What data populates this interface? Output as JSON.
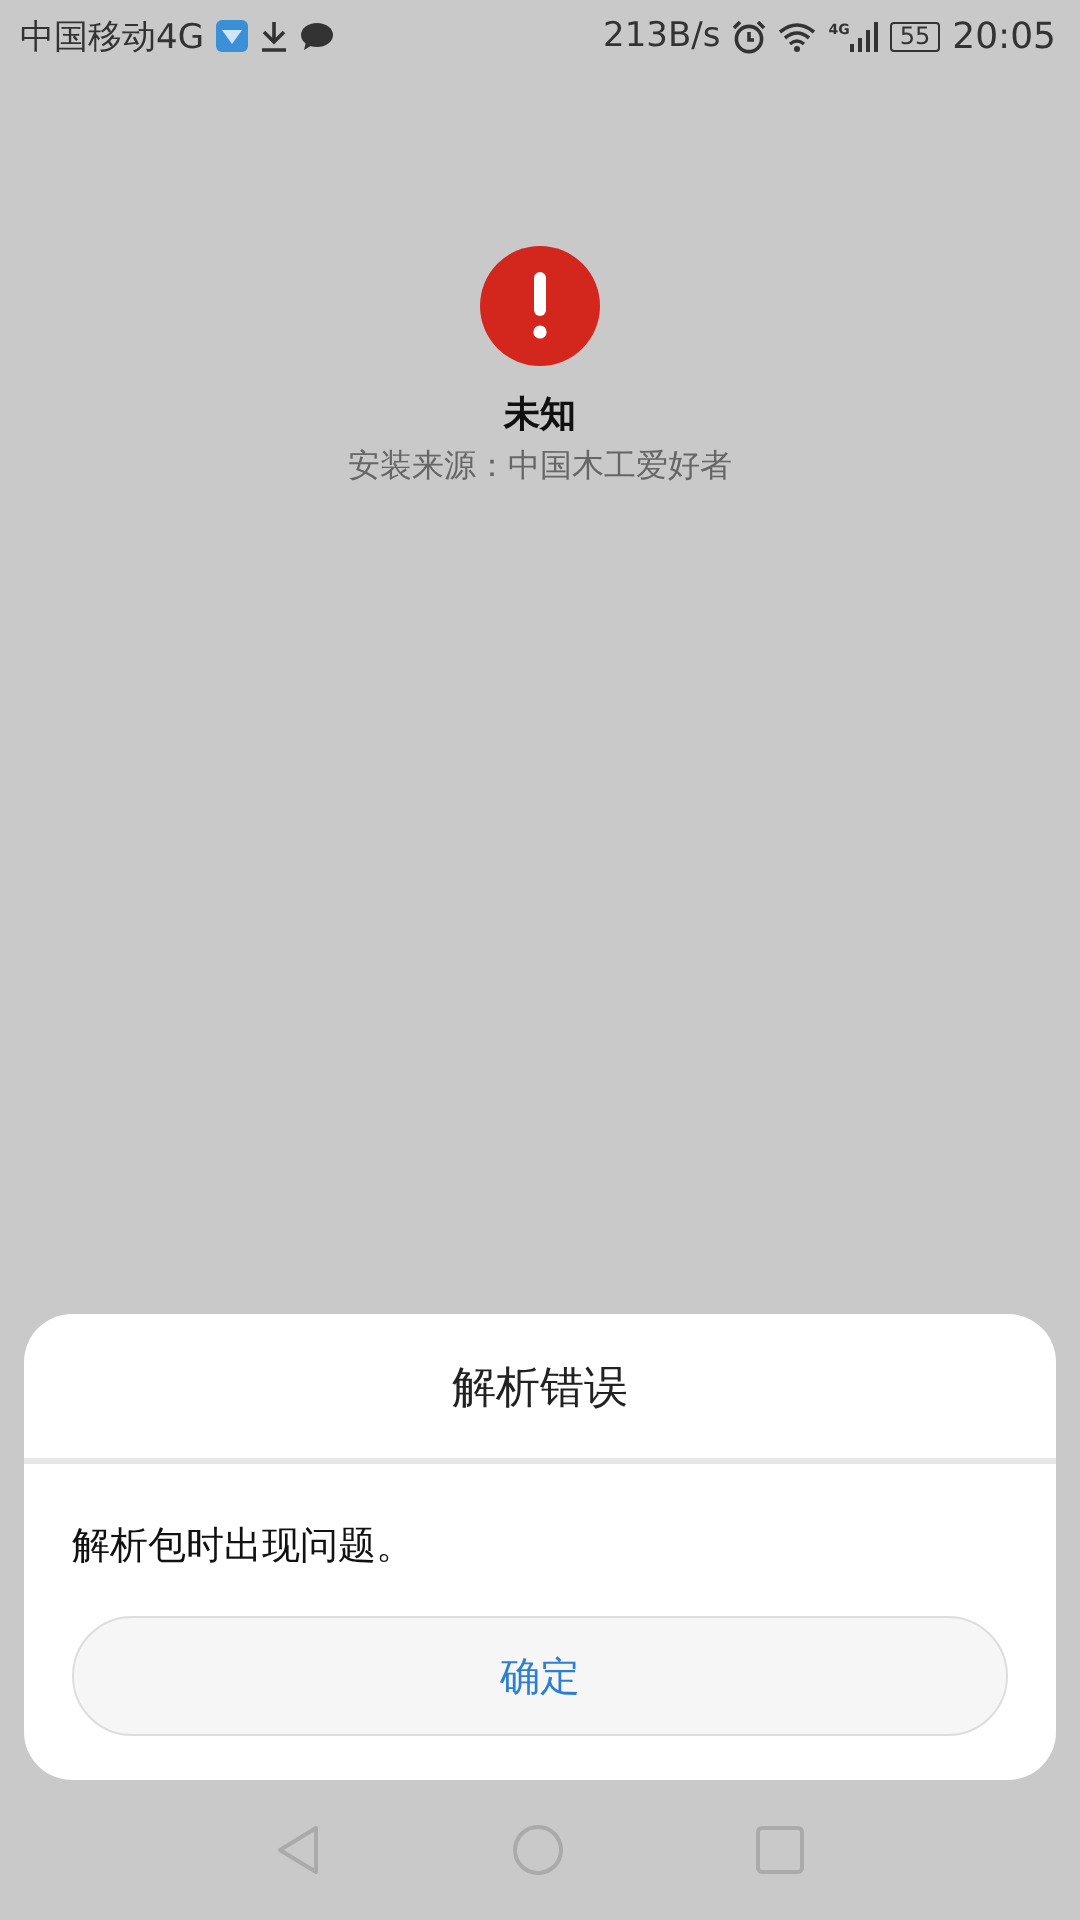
{
  "status_bar": {
    "carrier": "中国移动4G",
    "speed": "213B/s",
    "network_badge": "4G",
    "battery": "55",
    "time": "20:05"
  },
  "app_info": {
    "name": "未知",
    "source": "安装来源：中国木工爱好者"
  },
  "dialog": {
    "title": "解析错误",
    "message": "解析包时出现问题。",
    "button": "确定"
  }
}
